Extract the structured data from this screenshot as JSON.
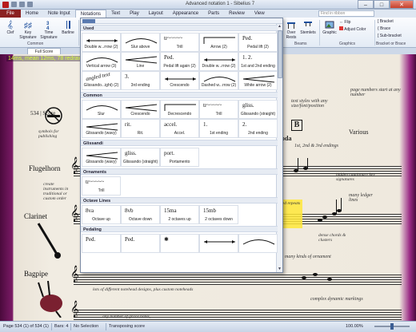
{
  "window": {
    "title": "Advanced notation 1 - Sibelius 7",
    "controls": [
      "–",
      "□",
      "✕"
    ]
  },
  "ribbon_tabs": [
    "File",
    "Home",
    "Note Input",
    "Notations",
    "Text",
    "Play",
    "Layout",
    "Appearance",
    "Parts",
    "Review",
    "View"
  ],
  "ribbon_search_placeholder": "Find in ribbon",
  "ribbon": {
    "common": {
      "clef": "Clef",
      "key_signature": "Key Signature",
      "time_signature": "Time Signature",
      "barline": "Barline",
      "group": "Common"
    },
    "over_rests": "Over Rests",
    "stemlets": "Stemlets",
    "beams_group": "Beams",
    "graphic": "Graphic",
    "flip": "Flip",
    "adjust_color": "Adjust Color",
    "graphics_group": "Graphics",
    "bracket": "Bracket",
    "brace": "Brace",
    "sub_bracket": "Sub-bracket",
    "bracket_group": "Bracket or Brace"
  },
  "document_tab": "Full Score",
  "redraw_stats": "14ms, mean 12ms, 78 redraws, 1 (1)",
  "score": {
    "instruments": [
      "Flugelhorn",
      "Clarinet",
      "Bagpipe"
    ],
    "annotations": {
      "score_bar": "534 | Score",
      "symbols_publishing": "symbols for publishing",
      "create_instruments": "create instruments in traditional or custom order",
      "text_styles": "text styles with any size/font/position",
      "page_numbers": "page numbers start at any number",
      "various": "Various",
      "endings": "1st, 2nd & 3rd endings",
      "coda": "oda",
      "key_signatures": "hidden cautionary key signatures",
      "ledger_lines": "many ledger lines",
      "repeats": "ged repeats",
      "dense_chords": "dense chords & clusters",
      "ornaments": "many kinds of ornament",
      "notehead": "lots of different notehead designs, plus custom noteheads",
      "complex_dynamics": "complex dynamic markings",
      "grace_notes": "any number of grace notes,"
    },
    "box_letter": "B"
  },
  "gallery": {
    "sections": [
      {
        "title": "Used",
        "items": [
          "Double w...rrow (2)",
          "Slur above",
          "Trill",
          "Arrow (2)",
          "Pedal lift (2)",
          "Vertical arrow (3)",
          "Line",
          "Pedal lift again (2)",
          "Double w...rrow (2)",
          "1st and 2nd ending",
          "Glissando...ight) (2)",
          "3rd ending",
          "Crescendo",
          "Dashed w...rrow (2)",
          "White arrow (2)"
        ],
        "glyphs": [
          "",
          "",
          "tr~~~~~",
          "",
          "Ped.",
          "",
          "",
          "Ped.",
          "",
          "1.  2.",
          "angled text",
          "3.",
          "",
          "",
          ""
        ]
      },
      {
        "title": "Common",
        "items": [
          "Slur",
          "Crescendo",
          "Decrescendo",
          "Trill",
          "Glissando (straight)",
          "Glissando (wavy)",
          "Rit.",
          "Accel.",
          "1st ending",
          "2nd ending"
        ],
        "glyphs": [
          "",
          "",
          "",
          "tr~~~~~",
          "gliss.",
          "",
          "rit.",
          "accel.",
          "1.",
          "2."
        ]
      },
      {
        "title": "Glissandi",
        "items": [
          "Glissando (wavy)",
          "Glissando (straight)",
          "Portamento"
        ],
        "glyphs": [
          "",
          "gliss.",
          "port."
        ]
      },
      {
        "title": "Ornaments",
        "items": [
          "Trill"
        ],
        "glyphs": [
          "tr~~~~~"
        ]
      },
      {
        "title": "Octave Lines",
        "items": [
          "Octave up",
          "Octave down",
          "2 octaves up",
          "2 octaves down"
        ],
        "glyphs": [
          "8va",
          "8vb",
          "15ma",
          "15mb"
        ]
      },
      {
        "title": "Pedaling",
        "items": [
          "",
          "",
          "",
          "",
          ""
        ],
        "glyphs": [
          "Ped.",
          "Ped.",
          "✱",
          "",
          ""
        ]
      }
    ]
  },
  "statusbar": {
    "page": "Page 534 (1) of 534 (1)",
    "bars": "Bars: 4",
    "selection": "No Selection",
    "transposing": "Transposing score",
    "zoom": "100.00%"
  }
}
